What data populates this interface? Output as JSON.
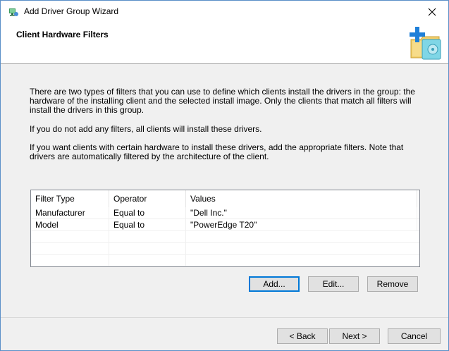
{
  "window": {
    "title": "Add Driver Group Wizard"
  },
  "header": {
    "title": "Client Hardware Filters"
  },
  "body": {
    "para1": "There are two types of filters that you can use to define which clients install the drivers in the group: the hardware of the installing client and the selected install image. Only the clients that match all filters will install the drivers in this group.",
    "para2": "If you do not add any filters, all clients will install these drivers.",
    "para3": "If you want clients with certain hardware to install these drivers, add the appropriate filters. Note that drivers are automatically filtered by the architecture of the client."
  },
  "filters": {
    "columns": [
      "Filter Type",
      "Operator",
      "Values"
    ],
    "rows": [
      [
        "Manufacturer",
        "Equal to",
        "\"Dell Inc.\""
      ],
      [
        "Model",
        "Equal to",
        "\"PowerEdge T20\""
      ]
    ]
  },
  "actions": {
    "add": "Add...",
    "edit": "Edit...",
    "remove": "Remove"
  },
  "nav": {
    "back": "< Back",
    "next": "Next >",
    "cancel": "Cancel"
  }
}
